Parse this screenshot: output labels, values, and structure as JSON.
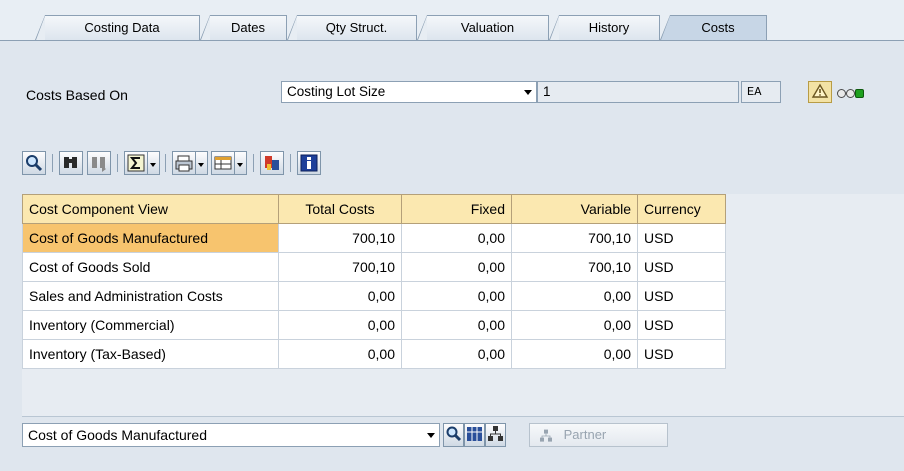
{
  "tabs": [
    {
      "label": "Costing Data"
    },
    {
      "label": "Dates"
    },
    {
      "label": "Qty Struct."
    },
    {
      "label": "Valuation"
    },
    {
      "label": "History"
    },
    {
      "label": "Costs",
      "active": true
    }
  ],
  "costs_based_on": {
    "label": "Costs Based On",
    "selected": "Costing Lot Size",
    "lot_size": "1",
    "unit": "EA"
  },
  "toolbar": {
    "icons": [
      "details-icon",
      "find-icon",
      "find-next-icon",
      "sum-icon",
      "print-icon",
      "layout-icon",
      "export-icon",
      "info-icon"
    ]
  },
  "table": {
    "columns": [
      "Cost Component View",
      "Total Costs",
      "Fixed",
      "Variable",
      "Currency"
    ],
    "rows": [
      [
        "Cost of Goods Manufactured",
        "700,10",
        "0,00",
        "700,10",
        "USD"
      ],
      [
        "Cost of Goods Sold",
        "700,10",
        "0,00",
        "700,10",
        "USD"
      ],
      [
        "Sales and Administration Costs",
        "0,00",
        "0,00",
        "0,00",
        "USD"
      ],
      [
        "Inventory (Commercial)",
        "0,00",
        "0,00",
        "0,00",
        "USD"
      ],
      [
        "Inventory (Tax-Based)",
        "0,00",
        "0,00",
        "0,00",
        "USD"
      ]
    ]
  },
  "bottom": {
    "view_select": "Cost of Goods Manufactured",
    "partner_label": "Partner"
  },
  "colors": {
    "header": "#fbe8b0",
    "selected_cell": "#f7c46e",
    "panel": "#dfe6ee",
    "light_green": "#1ea01e"
  }
}
